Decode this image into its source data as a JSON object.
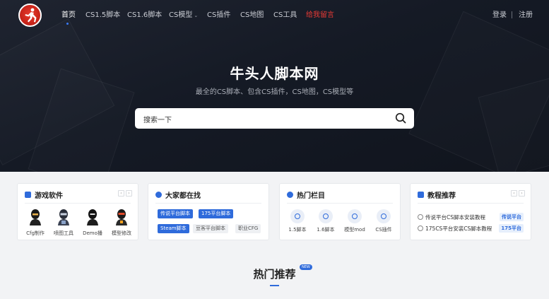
{
  "nav": {
    "items": [
      {
        "label": "首页"
      },
      {
        "label": "CS1.5脚本"
      },
      {
        "label": "CS1.6脚本"
      },
      {
        "label": "CS模型"
      },
      {
        "label": "CS插件"
      },
      {
        "label": "CS地图"
      },
      {
        "label": "CS工具"
      },
      {
        "label": "给我留言"
      }
    ],
    "login": "登录",
    "register": "注册"
  },
  "hero": {
    "title": "牛头人脚本网",
    "subtitle": "最全的CS脚本、包含CS插件，CS地图，CS模型等",
    "search_placeholder": "搜索一下"
  },
  "cards": {
    "software": {
      "title": "游戏软件",
      "items": [
        {
          "label": "Cfg制作"
        },
        {
          "label": "喷图工具"
        },
        {
          "label": "Demo播"
        },
        {
          "label": "模型修改"
        }
      ]
    },
    "search": {
      "title": "大家都在找",
      "tags": [
        {
          "label": "传说平台脚本"
        },
        {
          "label": "175平台脚本"
        },
        {
          "label": "Steam脚本"
        },
        {
          "label": "豆客平台脚本"
        },
        {
          "label": "职业CFG"
        }
      ]
    },
    "hot": {
      "title": "热门栏目",
      "items": [
        {
          "label": "1.5脚本"
        },
        {
          "label": "1.6脚本"
        },
        {
          "label": "模型mod"
        },
        {
          "label": "CS插件"
        }
      ]
    },
    "tutorial": {
      "title": "教程推荐",
      "items": [
        {
          "text": "传说平台CS脚本安装教程",
          "badge": "传说平台"
        },
        {
          "text": "175CS平台安装CS脚本教程",
          "badge": "175平台"
        }
      ]
    }
  },
  "section": {
    "title": "热门推荐",
    "badge": "NEW"
  },
  "colors": {
    "accent": "#2f6bdb",
    "nav_highlight": "#e83a35",
    "hero_bg": "#151a25"
  }
}
